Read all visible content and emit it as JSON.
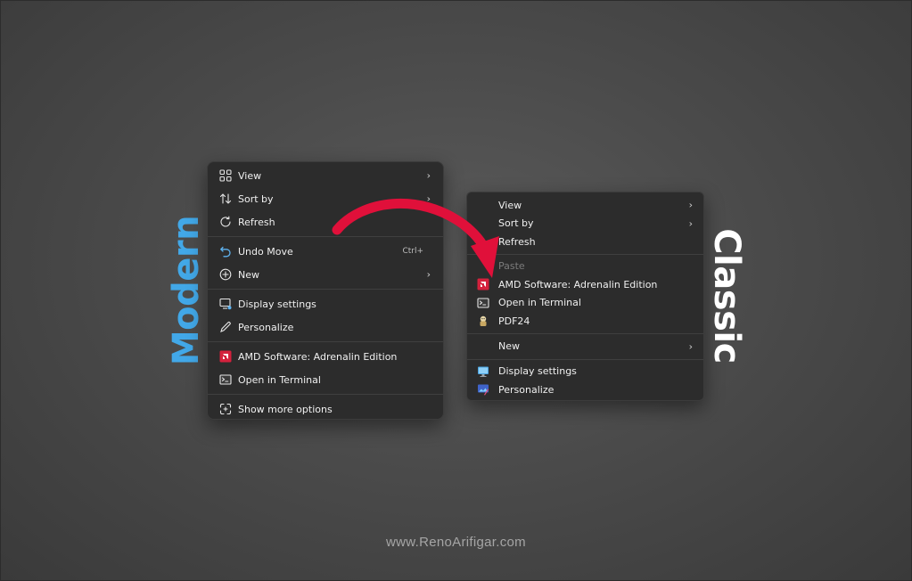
{
  "side_labels": {
    "modern": "Modern",
    "classic": "Classic"
  },
  "watermark": "www.RenoArifigar.com",
  "colors": {
    "modern_label": "#42a8e8",
    "classic_label": "#ffffff",
    "arrow": "#e0103a",
    "menu_bg": "#2c2c2c"
  },
  "modern_menu": {
    "items": [
      {
        "label": "View",
        "icon": "grid-icon",
        "submenu": true
      },
      {
        "label": "Sort by",
        "icon": "sort-icon",
        "submenu": true
      },
      {
        "label": "Refresh",
        "icon": "refresh-icon"
      },
      {
        "label": "Undo Move",
        "icon": "undo-icon",
        "shortcut": "Ctrl+"
      },
      {
        "label": "New",
        "icon": "plus-circle-icon",
        "submenu": true
      },
      {
        "label": "Display settings",
        "icon": "display-icon"
      },
      {
        "label": "Personalize",
        "icon": "pen-icon"
      },
      {
        "label": "AMD Software: Adrenalin Edition",
        "icon": "amd-icon"
      },
      {
        "label": "Open in Terminal",
        "icon": "terminal-icon"
      },
      {
        "label": "Show more options",
        "icon": "more-options-icon"
      }
    ]
  },
  "classic_menu": {
    "items": [
      {
        "label": "View",
        "submenu": true
      },
      {
        "label": "Sort by",
        "submenu": true
      },
      {
        "label": "Refresh"
      },
      {
        "label": "Paste",
        "disabled": true
      },
      {
        "label": "AMD Software: Adrenalin Edition",
        "icon": "amd-icon"
      },
      {
        "label": "Open in Terminal",
        "icon": "terminal-icon"
      },
      {
        "label": "PDF24",
        "icon": "pdf24-icon"
      },
      {
        "label": "New",
        "submenu": true
      },
      {
        "label": "Display settings",
        "icon": "monitor-icon"
      },
      {
        "label": "Personalize",
        "icon": "personalize-icon"
      }
    ]
  }
}
